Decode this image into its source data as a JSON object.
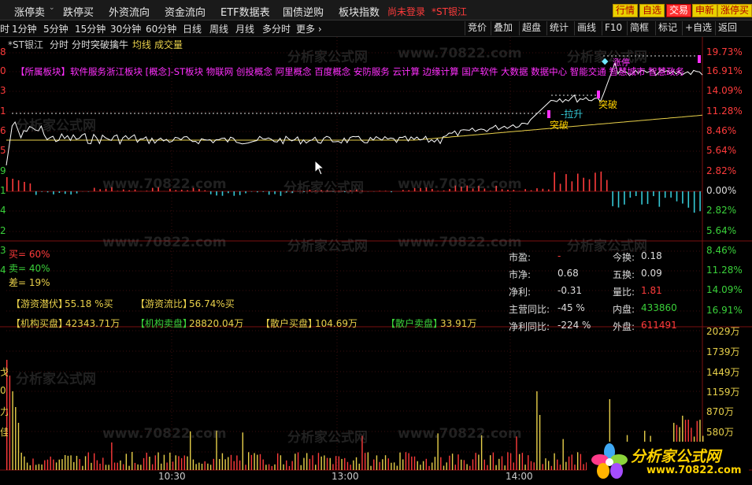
{
  "menubar": {
    "items": [
      "涨停卖",
      "跌停买",
      "外资流向",
      "资金流向",
      "ETF数据表",
      "国债逆购",
      "板块指数"
    ],
    "login_status": "尚未登录",
    "stock_name": "*ST银江",
    "right_buttons": [
      "行情",
      "自选",
      "交易",
      "申新",
      "涨停买"
    ]
  },
  "periodbar": {
    "left_cut": "时",
    "periods": [
      "1分钟",
      "5分钟",
      "15分钟",
      "30分钟",
      "60分钟",
      "日线",
      "周线",
      "月线",
      "多分时",
      "更多 ›"
    ],
    "tools": [
      "竞价",
      "叠加",
      "超盘",
      "统计",
      "画线",
      "F10",
      "简框",
      "标记",
      "+自选",
      "返回"
    ]
  },
  "chart": {
    "stock_label": "*ST银江",
    "view_label": "分时",
    "formula_label": "分时突破擒牛",
    "avg_label": "均线",
    "vol_label": "成交量",
    "sector_text": "【所属板块】软件服务浙江板块 [概念]-ST板块 物联网 创投概念 阿里概念 百度概念 安防服务 云计算 边缘计算 国产软件 大数据 数据中心 智能交通 智慧城市 智慧政务",
    "signals": [
      "突破",
      "突破",
      "-拉升",
      "涨停"
    ],
    "right_axis": [
      "19.73%",
      "16.91%",
      "14.09%",
      "11.28%",
      "8.46%",
      "5.64%",
      "2.82%",
      "0.00%",
      "2.82%",
      "5.64%",
      "8.46%",
      "11.28%",
      "14.09%",
      "16.91%"
    ],
    "left_axis": [
      "8",
      "0",
      "3",
      "1",
      "6",
      "5",
      "9",
      "1",
      "4",
      "2",
      "3",
      "4"
    ],
    "vol_axis": [
      "2029万",
      "1739万",
      "1449万",
      "1159万",
      "870万",
      "580万"
    ],
    "vol_left": [
      "戈",
      "0",
      "力",
      "佳"
    ],
    "time_labels": [
      "10:30",
      "13:00",
      "14:00"
    ],
    "watermark_cn": "分析家公式网",
    "watermark_url": "www.70822.com"
  },
  "panel": {
    "buy_ratio": "买= 60%",
    "sell_ratio": "卖= 40%",
    "diff_ratio": "差= 19%",
    "stats": [
      {
        "label": "【游资潜伏】",
        "value": "55.18 %买"
      },
      {
        "label": "【游资流比】",
        "value": "56.74%买"
      }
    ],
    "orders": [
      {
        "label": "【机构买盘】",
        "value": "42343.71万"
      },
      {
        "label": "【机构卖盘】",
        "value": "28820.04万"
      },
      {
        "label": "【散户买盘】",
        "value": "104.69万"
      },
      {
        "label": "【散户卖盘】",
        "value": "33.91万"
      }
    ],
    "fundamentals": [
      {
        "label": "市盈:",
        "value": "-",
        "label2": "今换:",
        "value2": "0.18"
      },
      {
        "label": "市净:",
        "value": "0.68",
        "label2": "五换:",
        "value2": "0.09"
      },
      {
        "label": "净利:",
        "value": "-0.31",
        "label2": "量比:",
        "value2": "1.81"
      },
      {
        "label": "主营同比:",
        "value": "-45 %",
        "label2": "内盘:",
        "value2": "433860"
      },
      {
        "label": "净利同比:",
        "value": "-224 %",
        "label2": "外盘:",
        "value2": "611491"
      }
    ]
  },
  "logo": {
    "main": "分析家公式网",
    "url": "www.70822.com"
  },
  "colors": {
    "up": "#ff3b3b",
    "down": "#35c9d6",
    "price": "#ffffff",
    "avg": "#e8d04a",
    "magenta": "#ff30ff",
    "green": "#3ad13a"
  }
}
